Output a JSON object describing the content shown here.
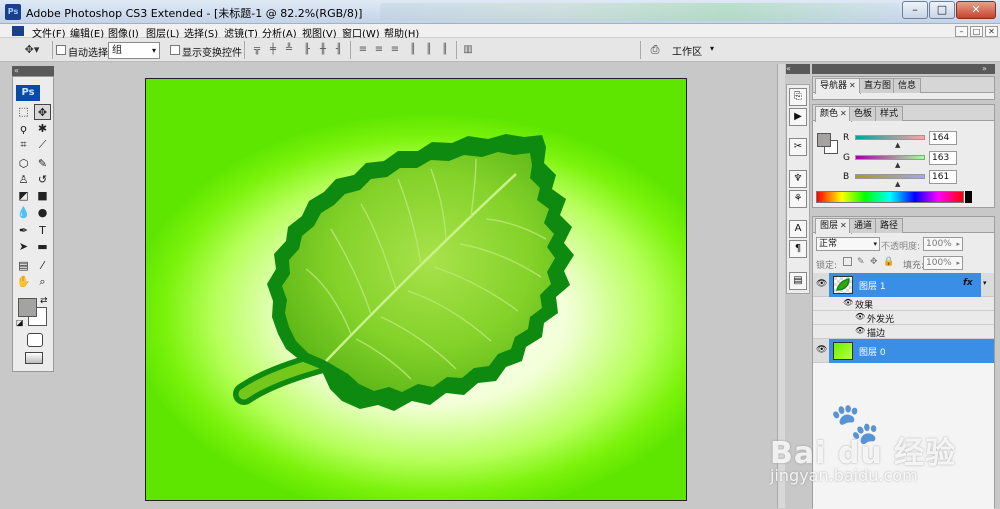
{
  "window": {
    "title": "Adobe Photoshop CS3 Extended - [未标题-1 @ 82.2%(RGB/8)]",
    "icon_label": "Ps",
    "controls": {
      "minimize": "–",
      "maximize": "□",
      "close": "✕"
    }
  },
  "menu": {
    "items": [
      "文件(F)",
      "编辑(E)",
      "图像(I)",
      "图层(L)",
      "选择(S)",
      "滤镜(T)",
      "分析(A)",
      "视图(V)",
      "窗口(W)",
      "帮助(H)"
    ],
    "doc_controls": [
      "–",
      "□",
      "✕"
    ]
  },
  "options_bar": {
    "auto_select_label": "自动选择:",
    "auto_select_value": "组",
    "show_transform_label": "显示变换控件",
    "workspace_label": "工作区"
  },
  "toolbox": {
    "logo": "Ps",
    "foreground_color": "#a3a3a1",
    "background_color": "#ffffff"
  },
  "canvas": {
    "background_colors": [
      "#5ee600",
      "#ffffff"
    ],
    "leaf_colors": {
      "outline": "#0d8a0f",
      "fill": "#74c81b",
      "highlight": "#a8e24a"
    }
  },
  "panels": {
    "navigator_tabs": [
      "导航器",
      "直方图",
      "信息"
    ],
    "color_tabs": [
      "颜色",
      "色板",
      "样式"
    ],
    "color_sliders": [
      {
        "label": "R",
        "value": "164"
      },
      {
        "label": "G",
        "value": "163"
      },
      {
        "label": "B",
        "value": "161"
      }
    ],
    "layers_tabs": [
      "图层",
      "通道",
      "路径"
    ],
    "blend_mode": "正常",
    "opacity_label": "不透明度:",
    "opacity_value": "100%",
    "lock_label": "锁定:",
    "fill_label": "填充:",
    "fill_value": "100%",
    "layers": [
      {
        "name": "图层 1",
        "fx": "fx",
        "selected": true
      },
      {
        "name": "图层 0",
        "selected": true
      }
    ],
    "effects_label": "效果",
    "effects": [
      "外发光",
      "描边"
    ]
  },
  "watermark": {
    "brand": "Bai du 经验",
    "url": "jingyan.baidu.com"
  }
}
